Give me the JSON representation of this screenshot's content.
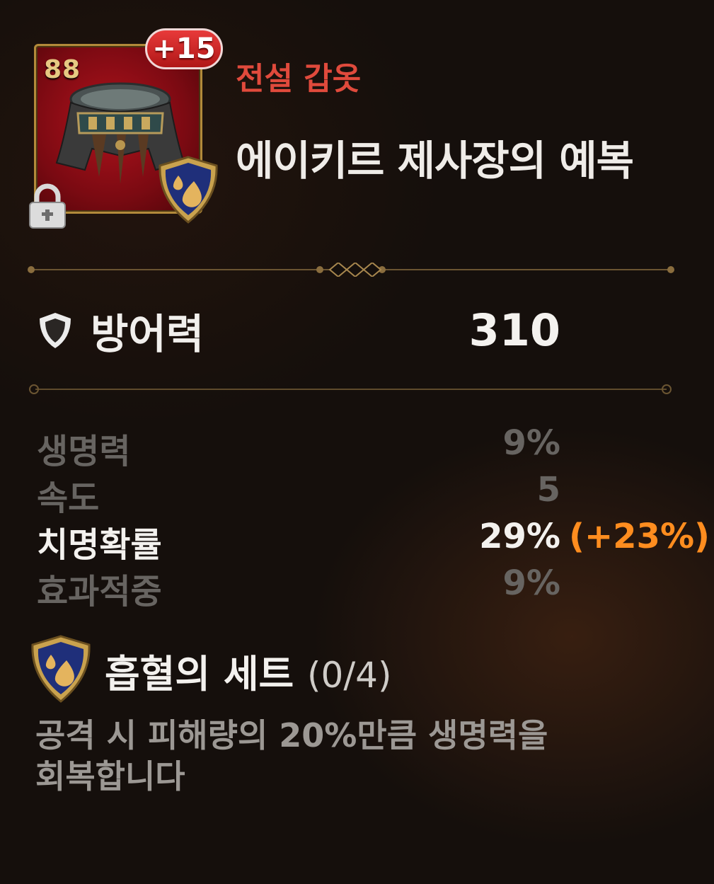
{
  "item": {
    "level": "88",
    "enhance": "+15",
    "grade": "전설 갑옷",
    "name": "에이키르 제사장의 예복",
    "locked": true,
    "icons": [
      "robe-item-icon",
      "lock-icon",
      "lifesteal-set-emblem"
    ]
  },
  "main_stat": {
    "label": "방어력",
    "value": "310",
    "icon": "shield-icon"
  },
  "stats": [
    {
      "label": "생명력",
      "value": "9%",
      "highlight": false
    },
    {
      "label": "속도",
      "value": "5",
      "highlight": false
    },
    {
      "label": "치명확률",
      "value": "29%",
      "bonus": "(+23%)",
      "highlight": true
    },
    {
      "label": "효과적중",
      "value": "9%",
      "highlight": false
    }
  ],
  "set": {
    "name": "흡혈의 세트",
    "count": "(0/4)",
    "description_line1": "공격 시 피해량의 20%만큼 생명력을",
    "description_line2": "회복합니다"
  },
  "colors": {
    "grade": "#e04a3c",
    "bonus": "#ff8d1f",
    "dim_stat": "#676461",
    "divider": "#6b5532"
  }
}
